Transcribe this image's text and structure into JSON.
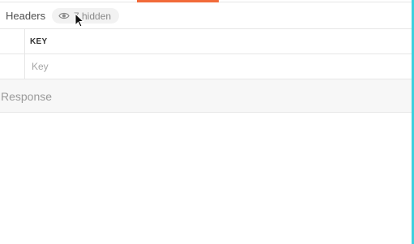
{
  "colors": {
    "accent": "#f26b3a",
    "edge": "#3fd0dd",
    "border": "#e6e6e6",
    "pill_bg": "#f2f2f2",
    "response_bg": "#f7f7f7"
  },
  "headers": {
    "label": "Headers",
    "hidden_pill": {
      "icon": "eye-icon",
      "text": "7 hidden"
    },
    "table": {
      "columns": [
        "KEY"
      ],
      "new_row": {
        "key_value": "",
        "key_placeholder": "Key"
      }
    }
  },
  "response": {
    "title": "Response"
  }
}
